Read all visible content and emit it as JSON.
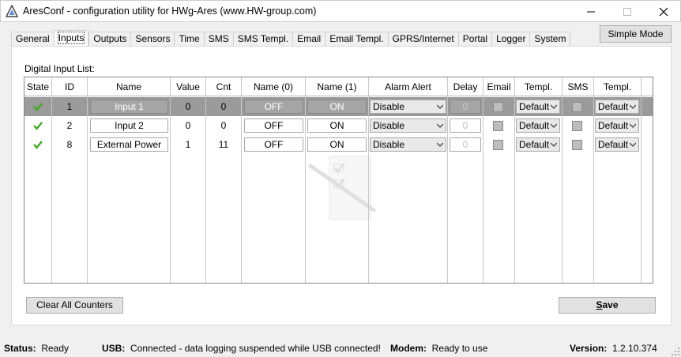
{
  "window": {
    "title": "AresConf - configuration utility for HWg-Ares (www.HW-group.com)"
  },
  "tabs": [
    "General",
    "Inputs",
    "Outputs",
    "Sensors",
    "Time",
    "SMS",
    "SMS Templ.",
    "Email",
    "Email Templ.",
    "GPRS/Internet",
    "Portal",
    "Logger",
    "System"
  ],
  "active_tab": "Inputs",
  "simple_mode_label": "Simple Mode",
  "list_label": "Digital Input List:",
  "columns": [
    "State",
    "ID",
    "Name",
    "Value",
    "Cnt",
    "Name (0)",
    "Name (1)",
    "Alarm Alert",
    "Delay",
    "Email",
    "Templ.",
    "SMS",
    "Templ."
  ],
  "rows": [
    {
      "id": "1",
      "name": "Input 1",
      "value": "0",
      "cnt": "0",
      "name0": "OFF",
      "name1": "ON",
      "alarm": "Disable",
      "delay": "0",
      "templ_email": "Default",
      "templ_sms": "Default",
      "selected": true
    },
    {
      "id": "2",
      "name": "Input 2",
      "value": "0",
      "cnt": "0",
      "name0": "OFF",
      "name1": "ON",
      "alarm": "Disable",
      "delay": "0",
      "templ_email": "Default",
      "templ_sms": "Default",
      "selected": false
    },
    {
      "id": "8",
      "name": "External Power",
      "value": "1",
      "cnt": "11",
      "name0": "OFF",
      "name1": "ON",
      "alarm": "Disable",
      "delay": "0",
      "templ_email": "Default",
      "templ_sms": "Default",
      "selected": false
    }
  ],
  "buttons": {
    "clear": "Clear All Counters",
    "save_prefix": "",
    "save_underlined": "S",
    "save_rest": "ave"
  },
  "status": {
    "status_label": "Status:",
    "status_value": "Ready",
    "usb_label": "USB:",
    "usb_value": "Connected - data logging suspended while USB connected!",
    "modem_label": "Modem:",
    "modem_value": "Ready to use",
    "version_label": "Version:",
    "version_value": "1.2.10.374"
  },
  "colors": {
    "selected_row": "#9b9b9b",
    "ok_check": "#3aa820"
  }
}
